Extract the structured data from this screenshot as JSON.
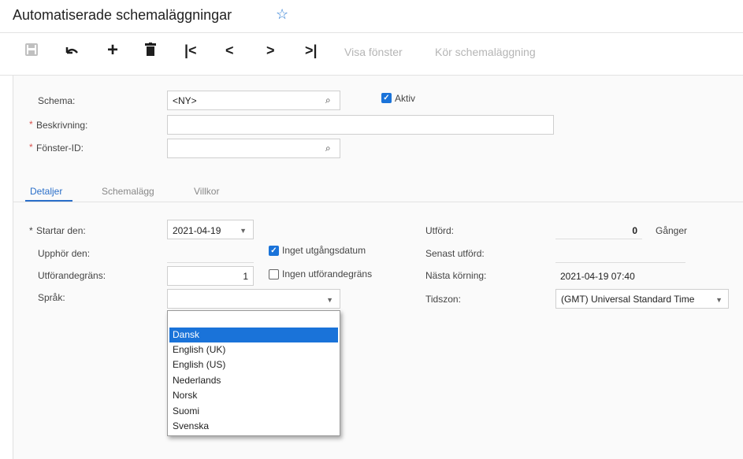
{
  "header": {
    "title": "Automatiserade schemaläggningar"
  },
  "toolbar": {
    "show_window": "Visa fönster",
    "run_schedule": "Kör schemaläggning"
  },
  "form": {
    "schema_label": "Schema:",
    "schema_value": "<NY>",
    "active_label": "Aktiv",
    "description_label": "Beskrivning:",
    "screen_id_label": "Fönster-ID:",
    "required_mark": "*"
  },
  "tabs": [
    "Detaljer",
    "Schemalägg",
    "Villkor"
  ],
  "details": {
    "starts_label": "Startar den:",
    "starts_value": "2021-04-19",
    "ends_label": "Upphör den:",
    "no_expiry_label": "Inget utgångsdatum",
    "limit_label": "Utförandegräns:",
    "limit_value": "1",
    "no_limit_label": "Ingen utförandegräns",
    "language_label": "Språk:",
    "executed_label": "Utförd:",
    "executed_value": "0",
    "times_label": "Gånger",
    "last_run_label": "Senast utförd:",
    "next_run_label": "Nästa körning:",
    "next_run_value": "2021-04-19 07:40",
    "timezone_label": "Tidszon:",
    "timezone_value": "(GMT) Universal Standard Time"
  },
  "language_dropdown": {
    "options": [
      "",
      "Dansk",
      "English (UK)",
      "English (US)",
      "Nederlands",
      "Norsk",
      "Suomi",
      "Svenska"
    ],
    "highlighted": "Dansk"
  },
  "colors": {
    "accent": "#1a73d9",
    "required": "#d9534f",
    "tab_active": "#2a6fc9"
  }
}
